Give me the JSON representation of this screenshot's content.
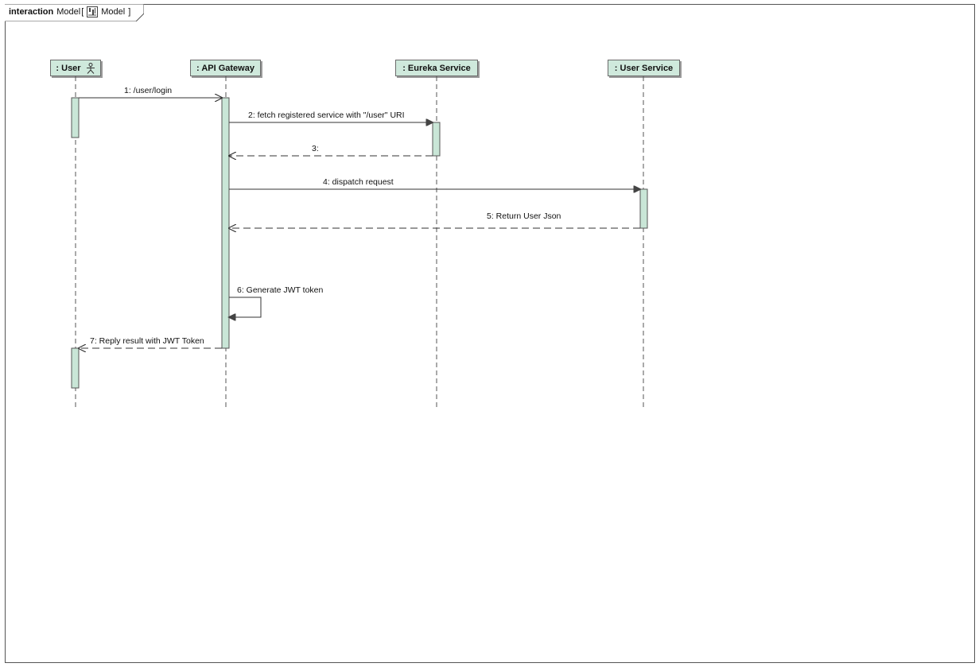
{
  "frame": {
    "kind": "interaction",
    "name": "Model",
    "bracket_open": "[",
    "model_label": "Model",
    "bracket_close": "]",
    "model_icon": "model-icon"
  },
  "lifelines": [
    {
      "id": "user",
      "label": ": User",
      "icon": "actor-icon"
    },
    {
      "id": "gateway",
      "label": ": API Gateway"
    },
    {
      "id": "eureka",
      "label": ": Eureka Service"
    },
    {
      "id": "userservice",
      "label": ": User Service"
    }
  ],
  "messages": [
    {
      "id": "m1",
      "label": "1: /user/login",
      "from": "user",
      "to": "gateway",
      "type": "sync"
    },
    {
      "id": "m2",
      "label": "2: fetch registered service with \"/user\" URI",
      "from": "gateway",
      "to": "eureka",
      "type": "sync"
    },
    {
      "id": "m3",
      "label": "3:",
      "from": "eureka",
      "to": "gateway",
      "type": "reply"
    },
    {
      "id": "m4",
      "label": "4: dispatch request",
      "from": "gateway",
      "to": "userservice",
      "type": "sync"
    },
    {
      "id": "m5",
      "label": "5: Return User Json",
      "from": "userservice",
      "to": "gateway",
      "type": "reply"
    },
    {
      "id": "m6",
      "label": "6: Generate JWT token",
      "from": "gateway",
      "to": "gateway",
      "type": "self"
    },
    {
      "id": "m7",
      "label": "7: Reply result with JWT Token",
      "from": "gateway",
      "to": "user",
      "type": "reply"
    }
  ],
  "colors": {
    "lifeline_fill": "#cfe9dc",
    "activation_fill": "#c9e6d7",
    "line": "#333333",
    "frame_border": "#555555"
  }
}
